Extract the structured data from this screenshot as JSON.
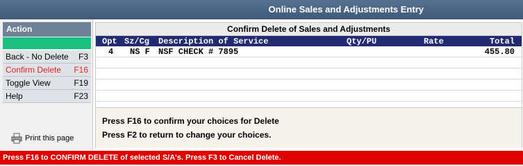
{
  "window": {
    "title": "Online Sales and Adjustments Entry"
  },
  "sidebar": {
    "heading": "Action",
    "items": [
      {
        "label": "Back - No Delete",
        "key": "F3",
        "active": false
      },
      {
        "label": "Confirm Delete",
        "key": "F16",
        "active": true
      },
      {
        "label": "Toggle View",
        "key": "F19",
        "active": false
      },
      {
        "label": "Help",
        "key": "F23",
        "active": false
      }
    ],
    "print_label": "Print this page"
  },
  "panel": {
    "title": "Confirm Delete of Sales and Adjustments",
    "columns": {
      "opt": "Opt",
      "szcg": "Sz/Cg",
      "desc": "Description of Service",
      "qty": "Qty/PU",
      "rate": "Rate",
      "total": "Total"
    },
    "rows": [
      {
        "opt": "4",
        "szcg": "NS F",
        "desc": "NSF CHECK # 7895",
        "qty": "",
        "rate": "",
        "total": "455.80"
      }
    ],
    "messages": [
      "Press F16 to confirm your choices for Delete",
      "Press F2 to return to change your choices."
    ]
  },
  "status": {
    "text": "Press F16 to CONFIRM DELETE of selected S/A's. Press F3 to Cancel Delete."
  },
  "colors": {
    "title_bar": "#4a6582",
    "status_bar": "#e00000",
    "column_header": "#222a72",
    "green_bar": "#1ac080",
    "active_item": "#e02020"
  }
}
